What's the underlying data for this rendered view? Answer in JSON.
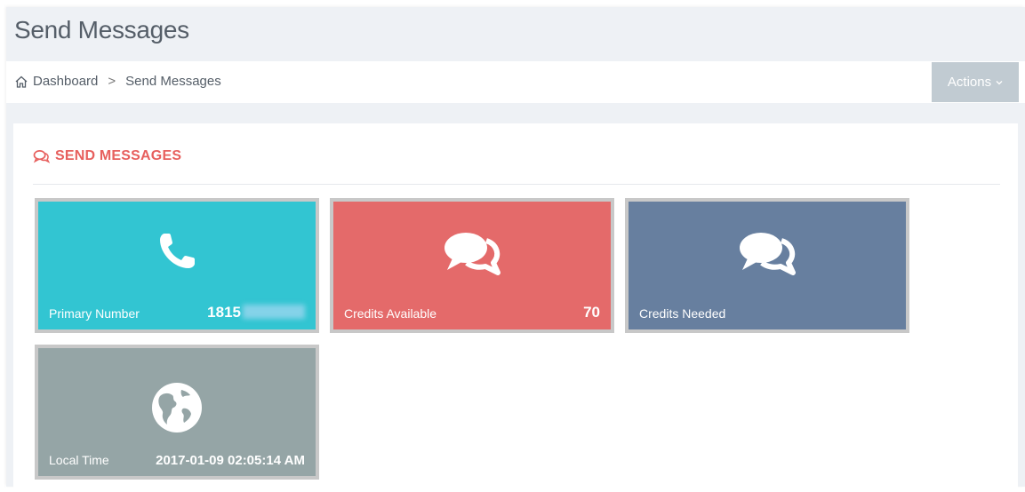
{
  "header": {
    "title": "Send Messages"
  },
  "breadcrumb": {
    "home": "Dashboard",
    "separator": ">",
    "current": "Send Messages"
  },
  "actions_button": {
    "label": "Actions"
  },
  "portlet": {
    "title": "SEND MESSAGES"
  },
  "tiles": [
    {
      "label": "Primary Number",
      "value": "1815",
      "icon": "phone-icon",
      "color": "#32c5d2"
    },
    {
      "label": "Credits Available",
      "value": "70",
      "icon": "comments-icon",
      "color": "#e46a6a"
    },
    {
      "label": "Credits Needed",
      "value": "",
      "icon": "comments-icon",
      "color": "#677f9f"
    },
    {
      "label": "Local Time",
      "value": "2017-01-09 02:05:14 AM",
      "icon": "globe-icon",
      "color": "#95a5a6"
    }
  ],
  "colors": {
    "accent": "#e7605e",
    "actions_bg": "#c1cbd2",
    "page_bg": "#eef1f5"
  }
}
